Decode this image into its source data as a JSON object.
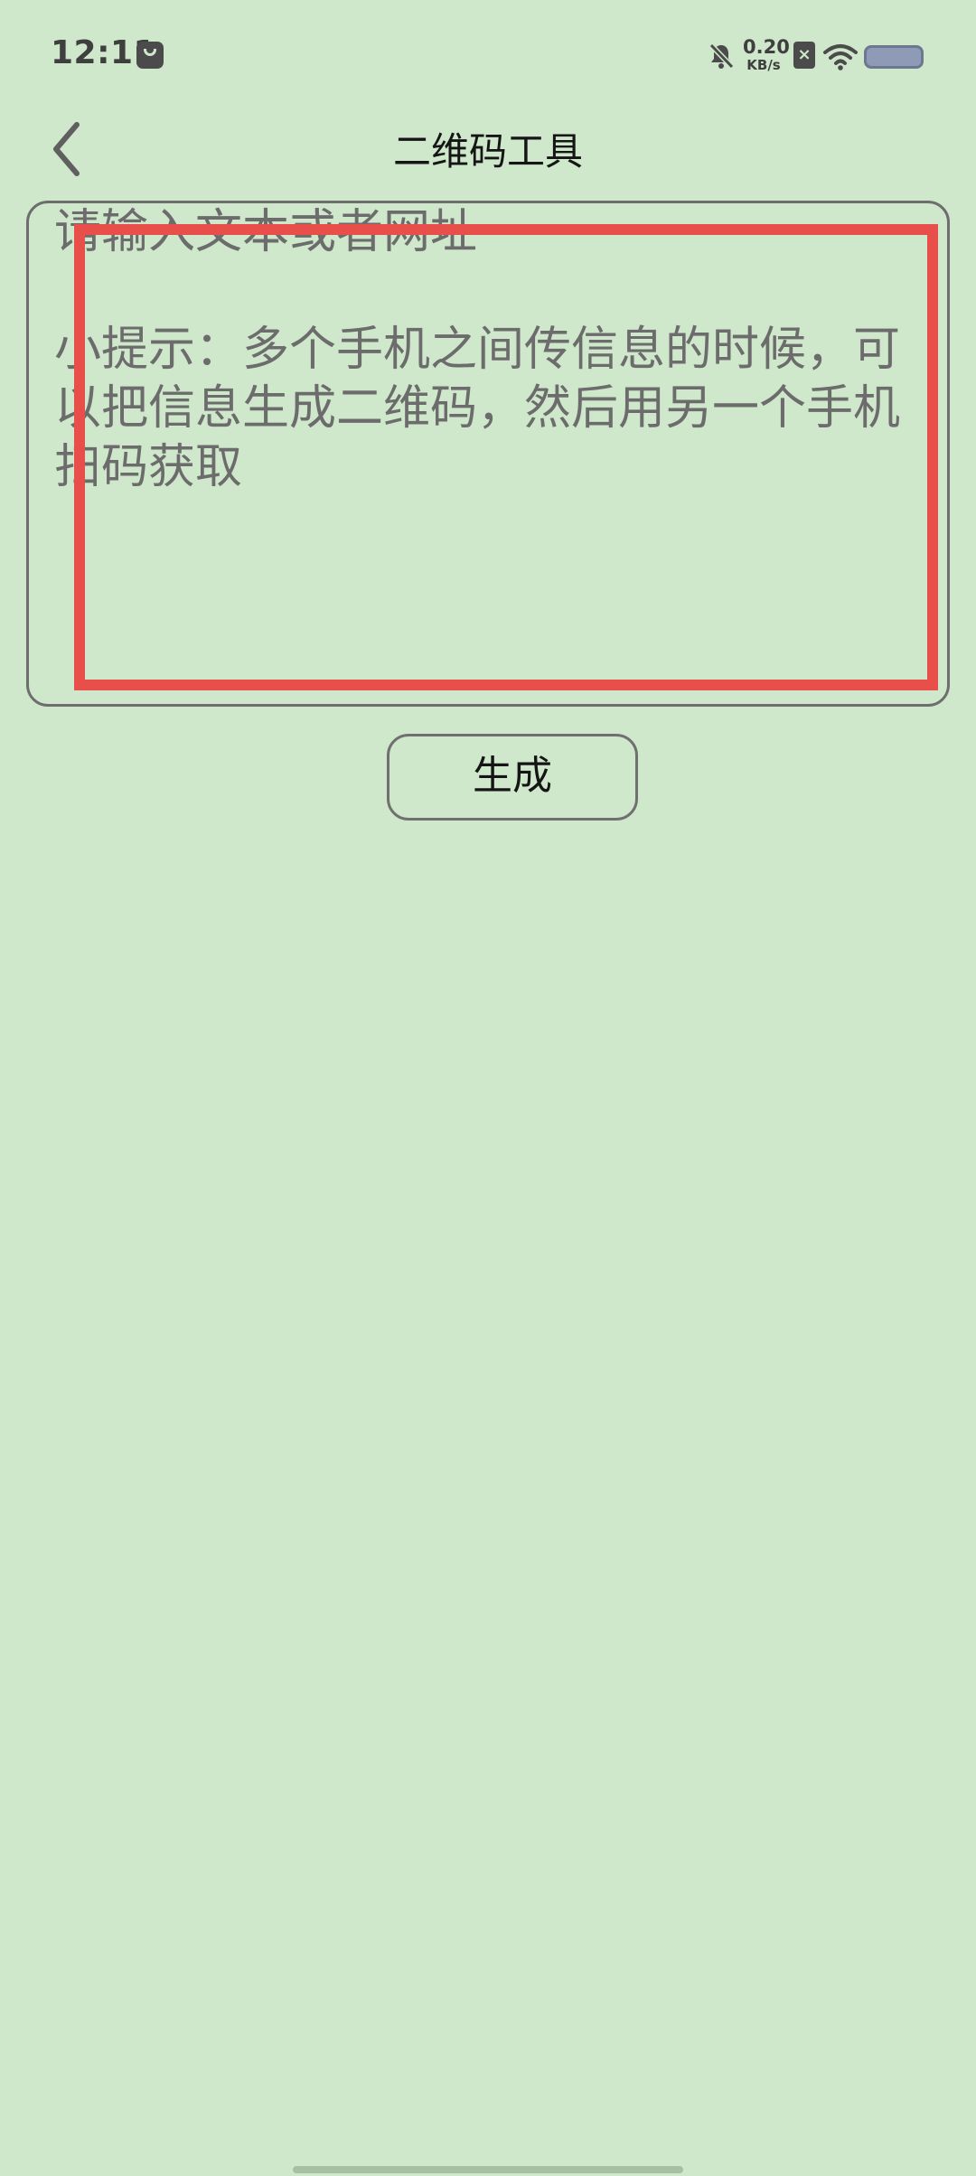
{
  "status_bar": {
    "time": "12:11",
    "net_speed_value": "0.20",
    "net_speed_unit": "KB/s",
    "icons": [
      "shopping-bag-icon",
      "mute-bell-icon",
      "sim-error-icon",
      "wifi-icon",
      "battery-icon"
    ]
  },
  "header": {
    "title": "二维码工具",
    "back_icon": "back-chevron-icon"
  },
  "main": {
    "input_placeholder": "请输入文本或者网址\n\n小提示：多个手机之间传信息的时候，可以把信息生成二维码，然后用另一个手机扫码获取",
    "generate_label": "生成"
  },
  "colors": {
    "background": "#cfe8cb",
    "highlight": "#e84f4b",
    "text": "#151515"
  }
}
